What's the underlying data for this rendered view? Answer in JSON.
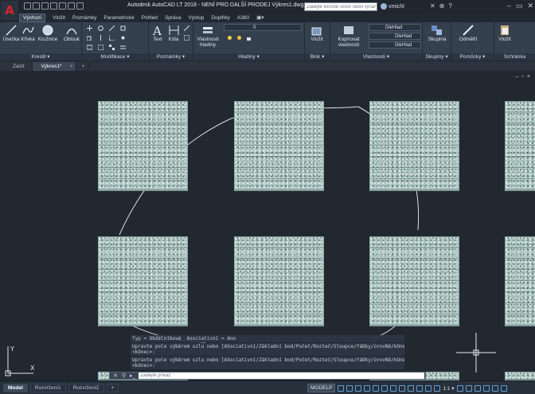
{
  "app": {
    "logo_letter": "A",
    "title": "Autodesk AutoCAD LT 2018 - NENÍ PRO DALŠÍ PRODEJ    Výkres1.dwg"
  },
  "search": {
    "placeholder": "Zadejte klíčové slovo nebo výraz"
  },
  "user": {
    "name": "vmichl"
  },
  "ribbon_tabs": [
    "Výchozí",
    "Vložit",
    "Poznámky",
    "Parametrické",
    "Pohled",
    "Správa",
    "Výstup",
    "Doplňky",
    "A360",
    "▣▾"
  ],
  "panels": {
    "kreslit": {
      "label": "Kreslit ▾",
      "tools": [
        "Úsečka",
        "Křivka",
        "Kružnice",
        "Oblouk"
      ]
    },
    "modifikace": {
      "label": "Modifikace ▾"
    },
    "poznamky": {
      "label": "Poznámky ▾",
      "tools": [
        "Text",
        "Kóta"
      ]
    },
    "hladiny": {
      "label": "Hladiny ▾",
      "tool": "Vlastnosti\nhladiny",
      "combo": "0"
    },
    "blok": {
      "label": "Blok ▾",
      "tool": "Vložit"
    },
    "vlastnosti": {
      "label": "Vlastnosti ▾",
      "tool": "Kopírovat\nvlastnosti",
      "combo1": "DleHlad",
      "combo2": "DleHlad",
      "combo3": "DleHlad"
    },
    "skupiny": {
      "label": "Skupiny ▾",
      "tool": "Skupina"
    },
    "pomucky": {
      "label": "Pomůcky ▾",
      "tool": "Odměřit"
    },
    "schranka": {
      "label": "Schránka",
      "tool": "Vložit"
    }
  },
  "doc_tabs": {
    "start": "Začít",
    "drawing": "Výkres1*",
    "close": "×",
    "plus": "+"
  },
  "viewport_controls": [
    "–",
    "▫",
    "×"
  ],
  "command_history": [
    "Typ = Obdélníkové  Asociativní = Ano",
    "Upravte pole výběrem uzlu nebo [ASociativní/Základní bod/Počet/Rozteč/Sloupce/řáDky/úrovNě/kOnec]\n<kOnec>:",
    "Upravte pole výběrem uzlu nebo [ASociativní/Základní bod/Počet/Rozteč/Sloupce/řáDky/úrovNě/kOnec]\n<kOnec>:"
  ],
  "command_input": {
    "placeholder": "Zadejte příkaz",
    "buttons": [
      "✕",
      "⚲",
      "▸_"
    ]
  },
  "layout_tabs": [
    "Model",
    "Rozvržení1",
    "Rozvržení2",
    "+"
  ],
  "status": {
    "model": "MODELP",
    "scale": "1:1 ▾"
  },
  "ucs": {
    "x": "X",
    "y": "Y"
  }
}
